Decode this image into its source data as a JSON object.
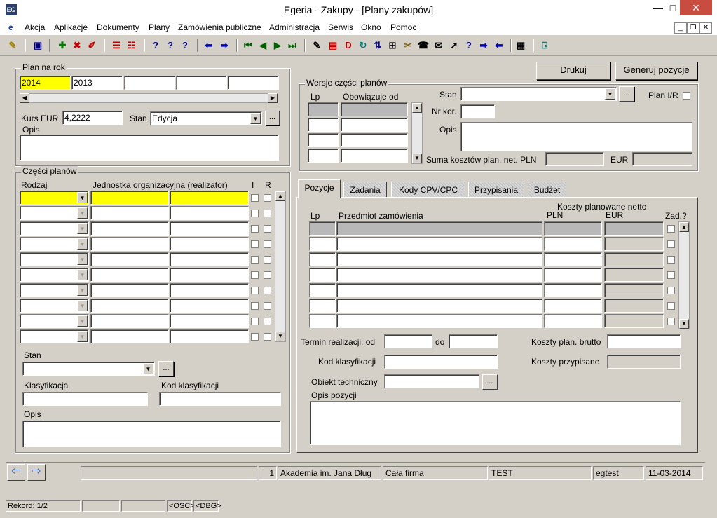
{
  "window": {
    "title": "Egeria - Zakupy - [Plany zakupów]",
    "icon": "app-icon"
  },
  "menu": [
    "Akcja",
    "Aplikacje",
    "Dokumenty",
    "Plany",
    "Zamówienia publiczne",
    "Administracja",
    "Serwis",
    "Okno",
    "Pomoc"
  ],
  "plan": {
    "label": "Plan na rok",
    "years": [
      "2014",
      "2013",
      "",
      "",
      ""
    ],
    "kurs_label": "Kurs EUR",
    "kurs_value": "4,2222",
    "stan_label": "Stan",
    "stan_value": "Edycja",
    "opis_label": "Opis",
    "ellipsis": "..."
  },
  "czesci": {
    "label": "Części planów",
    "col_rodzaj": "Rodzaj",
    "col_jednostka": "Jednostka organizacyjna (realizator)",
    "col_i": "I",
    "col_r": "R",
    "stan_label": "Stan",
    "klasyfikacja_label": "Klasyfikacja",
    "kod_label": "Kod klasyfikacji",
    "opis_label": "Opis"
  },
  "wersje": {
    "label": "Wersje części planów",
    "col_lp": "Lp",
    "col_obow": "Obowiązuje od",
    "stan_label": "Stan",
    "plan_ir_label": "Plan I/R",
    "nrkor_label": "Nr kor.",
    "opis_label": "Opis",
    "suma_label": "Suma kosztów plan. net. PLN",
    "eur_label": "EUR"
  },
  "buttons": {
    "drukuj": "Drukuj",
    "generuj": "Generuj pozycje"
  },
  "tabs": [
    "Pozycje",
    "Zadania",
    "Kody CPV/CPC",
    "Przypisania",
    "Budżet"
  ],
  "pozycje": {
    "col_lp": "Lp",
    "col_przedmiot": "Przedmiot zamówienia",
    "col_koszty": "Koszty planowane netto",
    "col_pln": "PLN",
    "col_eur": "EUR",
    "col_zad": "Zad.?",
    "termin_label": "Termin realizacji: od",
    "do_label": "do",
    "brutto_label": "Koszty plan. brutto",
    "kod_label": "Kod klasyfikacji",
    "przypisane_label": "Koszty przypisane",
    "obiekt_label": "Obiekt techniczny",
    "opis_label": "Opis pozycji"
  },
  "status": {
    "record_num": "1",
    "org": "Akademia im. Jana Dług",
    "scope": "Cała firma",
    "env": "TEST",
    "user": "egtest",
    "date": "11-03-2014"
  },
  "bottom": {
    "rekord": "Rekord: 1/2",
    "osc": "<OSC>",
    "dbg": "<DBG>"
  }
}
